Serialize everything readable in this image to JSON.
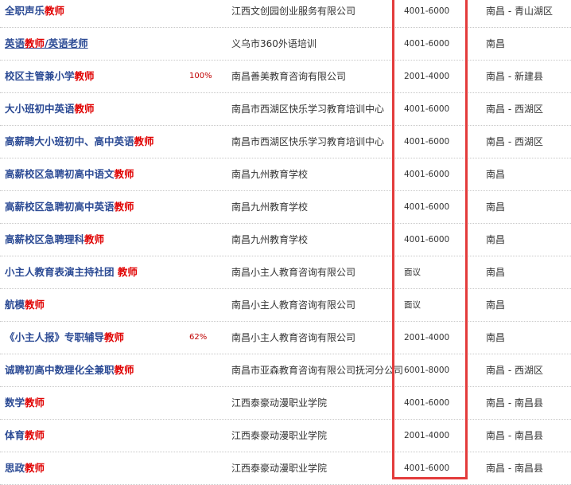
{
  "highlight_color": "#e33b3b",
  "rows": [
    {
      "title": "全职声乐",
      "kw": "教师",
      "rest": "",
      "pct": "",
      "company": "江西文创园创业服务有限公司",
      "salary": "4001-6000",
      "location": "南昌 - 青山湖区"
    },
    {
      "title": "英语",
      "kw": "教师",
      "rest": "/英语老师",
      "pct": "",
      "company": "义乌市360外语培训",
      "salary": "4001-6000",
      "location": "南昌"
    },
    {
      "title": "校区主管兼小学",
      "kw": "教师",
      "rest": "",
      "pct": "100%",
      "company": "南昌善美教育咨询有限公司",
      "salary": "2001-4000",
      "location": "南昌 - 新建县"
    },
    {
      "title": "大小班初中英语",
      "kw": "教师",
      "rest": "",
      "pct": "",
      "company": "南昌市西湖区快乐学习教育培训中心",
      "salary": "4001-6000",
      "location": "南昌 - 西湖区"
    },
    {
      "title": "高薪聘大小班初中、高中英语",
      "kw": "教师",
      "rest": "",
      "pct": "",
      "company": "南昌市西湖区快乐学习教育培训中心",
      "salary": "4001-6000",
      "location": "南昌 - 西湖区"
    },
    {
      "title": "高薪校区急聘初高中语文",
      "kw": "教师",
      "rest": "",
      "pct": "",
      "company": "南昌九州教育学校",
      "salary": "4001-6000",
      "location": "南昌"
    },
    {
      "title": "高薪校区急聘初高中英语",
      "kw": "教师",
      "rest": "",
      "pct": "",
      "company": "南昌九州教育学校",
      "salary": "4001-6000",
      "location": "南昌"
    },
    {
      "title": "高薪校区急聘理科",
      "kw": "教师",
      "rest": "",
      "pct": "",
      "company": "南昌九州教育学校",
      "salary": "4001-6000",
      "location": "南昌"
    },
    {
      "title": "小主人教育表演主持社团 ",
      "kw": "教师",
      "rest": "",
      "pct": "",
      "company": "南昌小主人教育咨询有限公司",
      "salary": "面议",
      "location": "南昌"
    },
    {
      "title": "航模",
      "kw": "教师",
      "rest": "",
      "pct": "",
      "company": "南昌小主人教育咨询有限公司",
      "salary": "面议",
      "location": "南昌"
    },
    {
      "title": "《小主人报》专职辅导",
      "kw": "教师",
      "rest": "",
      "pct": "62%",
      "company": "南昌小主人教育咨询有限公司",
      "salary": "2001-4000",
      "location": "南昌"
    },
    {
      "title": "诚聘初高中数理化全兼职",
      "kw": "教师",
      "rest": "",
      "pct": "",
      "company": "南昌市亚森教育咨询有限公司抚河分公司",
      "salary": "6001-8000",
      "location": "南昌 - 西湖区"
    },
    {
      "title": "数学",
      "kw": "教师",
      "rest": "",
      "pct": "",
      "company": "江西泰豪动漫职业学院",
      "salary": "4001-6000",
      "location": "南昌 - 南昌县"
    },
    {
      "title": "体育",
      "kw": "教师",
      "rest": "",
      "pct": "",
      "company": "江西泰豪动漫职业学院",
      "salary": "2001-4000",
      "location": "南昌 - 南昌县"
    },
    {
      "title": "思政",
      "kw": "教师",
      "rest": "",
      "pct": "",
      "company": "江西泰豪动漫职业学院",
      "salary": "4001-6000",
      "location": "南昌 - 南昌县"
    }
  ]
}
